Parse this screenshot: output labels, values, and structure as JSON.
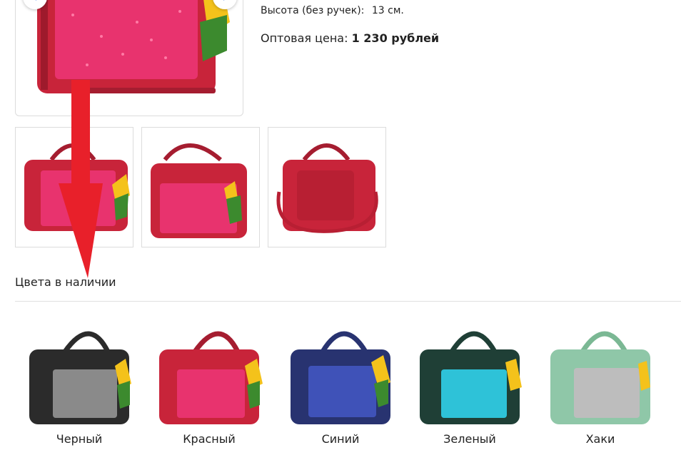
{
  "product": {
    "height_label": "Высота (без ручек):",
    "height_value": "13 см.",
    "price_label": "Оптовая цена:",
    "price_value": "1 230 рублей"
  },
  "gallery": {
    "prev_icon": "‹",
    "next_icon": "›",
    "main_bag_color": "#c8243a",
    "thumbnails": [
      {
        "bag_color": "#c8243a"
      },
      {
        "bag_color": "#c8243a"
      },
      {
        "bag_color": "#c8243a"
      }
    ]
  },
  "colors_section": {
    "title": "Цвета в наличии",
    "items": [
      {
        "label": "Черный",
        "bag_color": "#2b2b2b",
        "sparkle_color": "#8a8a8a"
      },
      {
        "label": "Красный",
        "bag_color": "#c8243a",
        "sparkle_color": "#e8336e"
      },
      {
        "label": "Синий",
        "bag_color": "#283370",
        "sparkle_color": "#3f52b8"
      },
      {
        "label": "Зеленый",
        "bag_color": "#1f3f36",
        "sparkle_color": "#2ec2d8"
      },
      {
        "label": "Хаки",
        "bag_color": "#8fc7a8",
        "sparkle_color": "#bdbdbd"
      }
    ]
  },
  "annotation": {
    "arrow_color": "#e8202a"
  }
}
